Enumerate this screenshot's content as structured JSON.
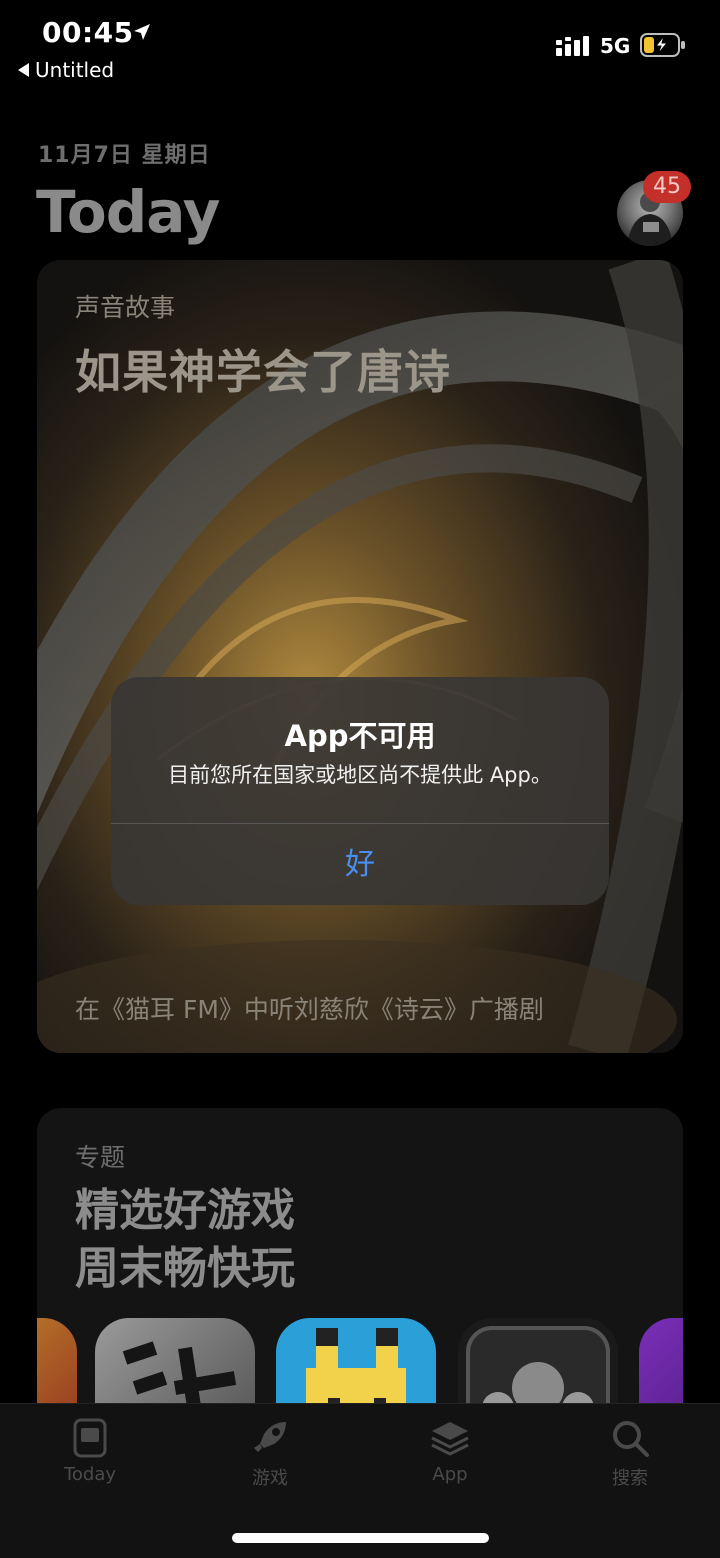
{
  "status_bar": {
    "time": "00:45",
    "back_label": "Untitled",
    "network": "5G"
  },
  "header": {
    "date": "11月7日 星期日",
    "title": "Today",
    "badge_count": "45"
  },
  "featured_card": {
    "eyebrow": "声音故事",
    "title": "如果神学会了唐诗",
    "caption": "在《猫耳 FM》中听刘慈欣《诗云》广播剧"
  },
  "topic_card": {
    "eyebrow": "专题",
    "title_line1": "精选好游戏",
    "title_line2": "周末畅快玩"
  },
  "alert": {
    "title": "App不可用",
    "message": "目前您所在国家或地区尚不提供此 App。",
    "button": "好"
  },
  "tab_bar": {
    "tabs": [
      {
        "label": "Today",
        "icon": "today-icon"
      },
      {
        "label": "游戏",
        "icon": "rocket-icon"
      },
      {
        "label": "App",
        "icon": "stack-icon"
      },
      {
        "label": "搜索",
        "icon": "search-icon"
      }
    ]
  },
  "colors": {
    "alert_button": "#4a8ff0",
    "badge": "#c3302a",
    "battery_charge": "#f2c230"
  }
}
